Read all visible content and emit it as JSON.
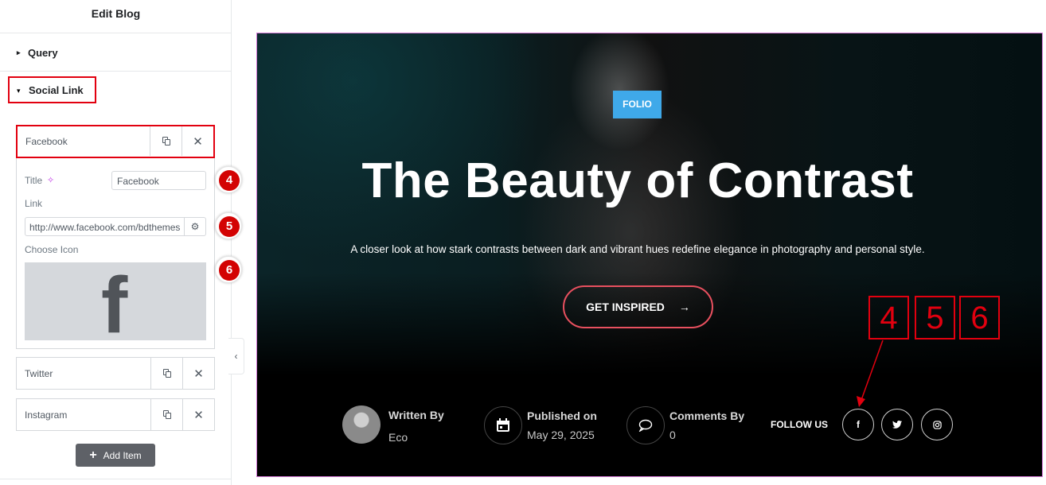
{
  "panel": {
    "title": "Edit Blog",
    "sections": {
      "query": "Query",
      "social_link": "Social Link"
    },
    "caret_collapsed": "▸",
    "caret_expanded": "▾",
    "items": [
      {
        "name": "Facebook"
      },
      {
        "name": "Twitter"
      },
      {
        "name": "Instagram"
      }
    ],
    "fields": {
      "title_label": "Title",
      "title_value": "Facebook",
      "link_label": "Link",
      "link_value": "http://www.facebook.com/bdthemes",
      "choose_icon_label": "Choose Icon",
      "icon_preview": "f"
    },
    "add_item_label": "Add Item",
    "collapse_glyph": "‹",
    "badges": [
      "4",
      "5",
      "6"
    ]
  },
  "hero": {
    "category": "FOLIO",
    "title": "The Beauty of Contrast",
    "description": "A closer look at how stark contrasts between dark and vibrant hues redefine elegance in photography and personal style.",
    "cta_label": "GET INSPIRED",
    "cta_arrow": "→",
    "annotations": [
      "4",
      "5",
      "6"
    ],
    "meta": {
      "written_by_label": "Written By",
      "author": "Eco",
      "published_label": "Published on",
      "date": "May 29, 2025",
      "comments_label": "Comments By",
      "comments_count": "0"
    },
    "follow_label": "FOLLOW US",
    "social_icons": [
      "facebook-icon",
      "twitter-icon",
      "instagram-icon"
    ]
  },
  "colors": {
    "highlight_red": "#e2000f",
    "badge_red": "#d30303",
    "category_blue": "#3fa9e9",
    "cta_border": "#e8505f",
    "add_button": "#5e6167"
  }
}
